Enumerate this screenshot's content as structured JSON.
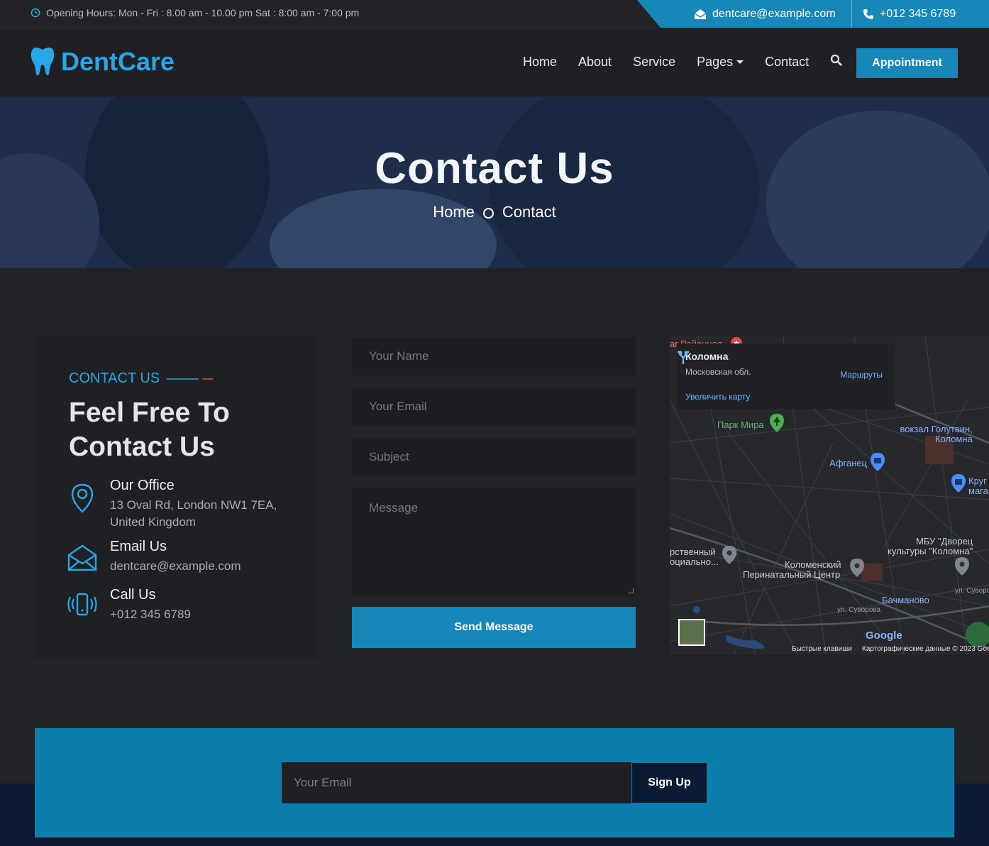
{
  "topbar": {
    "hours": "Opening Hours: Mon - Fri : 8.00 am - 10.00 pm Sat : 8:00 am - 7:00 pm",
    "email": "dentcare@example.com",
    "phone": "+012 345 6789"
  },
  "brand": {
    "name": "DentCare",
    "accent": "#28a6e6"
  },
  "nav": {
    "items": [
      "Home",
      "About",
      "Service",
      "Pages",
      "Contact"
    ],
    "appointment": "Appointment"
  },
  "hero": {
    "title": "Contact Us",
    "breadcrumb": [
      "Home",
      "Contact"
    ]
  },
  "contact": {
    "subtitle": "CONTACT US",
    "heading_line1": "Feel Free To",
    "heading_line2": "Contact Us",
    "office_title": "Our Office",
    "office_line1": "13 Oval Rd, London NW1 7EA,",
    "office_line2": "United Kingdom",
    "email_title": "Email Us",
    "email_value": "dentcare@example.com",
    "call_title": "Call Us",
    "call_value": "+012 345 6789"
  },
  "form": {
    "name_placeholder": "Your Name",
    "email_placeholder": "Your Email",
    "subject_placeholder": "Subject",
    "message_placeholder": "Message",
    "send": "Send Message"
  },
  "map": {
    "city": "Коломна",
    "region": "Московская обл.",
    "enlarge": "Увеличить карту",
    "routes": "Маршруты",
    "labels": {
      "top": "ar Районная",
      "park": "Парк Мира",
      "station_1": "вокзал Голутвин,",
      "station_2": "Коломна",
      "afganets": "Афганец",
      "krug_1": "Круг",
      "krug_2": "мага",
      "dvorets_1": "МБУ \"Дворец",
      "dvorets_2": "культуры \"Коломна\"",
      "left_1": "рственный",
      "left_2": "оциально...",
      "perinatal_1": "Коломенский",
      "perinatal_2": "Перинатальный Центр",
      "bachmanovo": "Бачманово",
      "street_1": "ул. Суворова",
      "street_2": "ул. Суворо"
    },
    "google": "Google",
    "shortcuts": "Быстрые клавиши",
    "copyright": "Картографические данные © 2023 Goo"
  },
  "newsletter": {
    "placeholder": "Your Email",
    "signup": "Sign Up"
  },
  "colors": {
    "primary": "#1687b8",
    "dark": "#222326",
    "navy": "#0b1a33",
    "accent_red": "#c0392b"
  }
}
